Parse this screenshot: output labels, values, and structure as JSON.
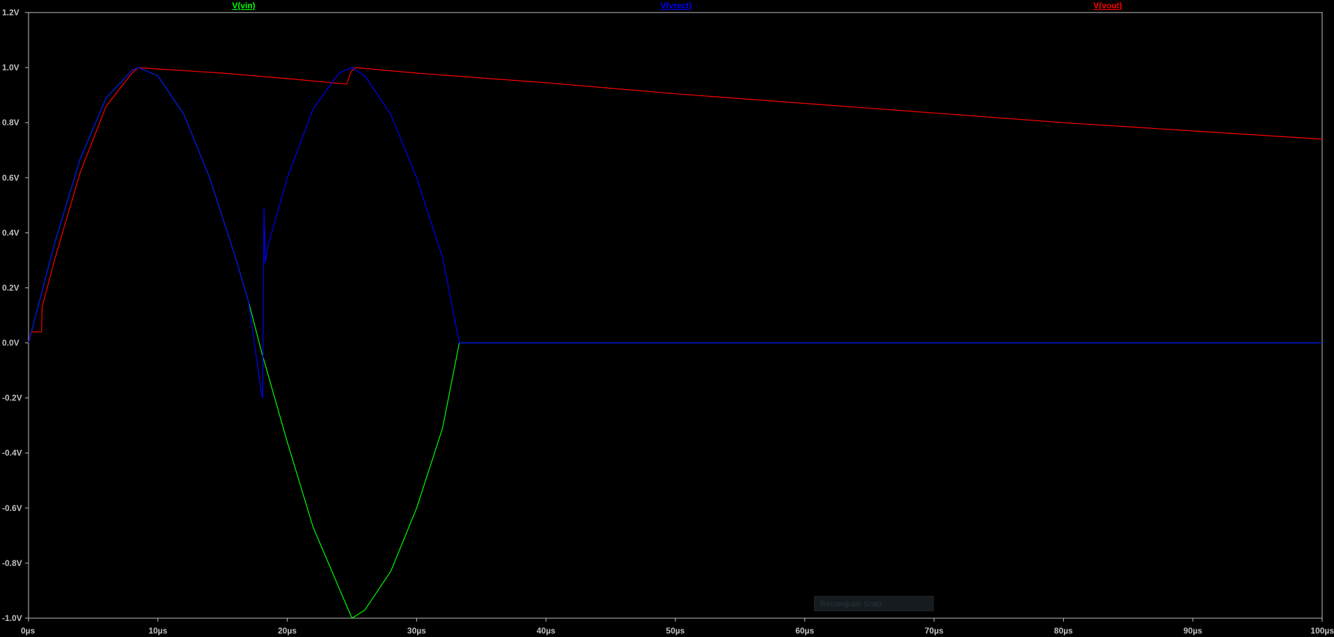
{
  "chart_data": {
    "type": "line",
    "x_unit": "µs",
    "y_unit": "V",
    "xlim": [
      0,
      100
    ],
    "ylim": [
      -1.0,
      1.2
    ],
    "x_ticks": [
      "0µs",
      "10µs",
      "20µs",
      "30µs",
      "40µs",
      "50µs",
      "60µs",
      "70µs",
      "80µs",
      "90µs",
      "100µs"
    ],
    "y_ticks": [
      "1.2V",
      "1.0V",
      "0.8V",
      "0.6V",
      "0.4V",
      "0.2V",
      "0.0V",
      "-0.2V",
      "-0.4V",
      "-0.6V",
      "-0.8V",
      "-1.0V"
    ],
    "series": [
      {
        "name": "V(vin)",
        "color": "#00ff00",
        "x": [
          0,
          2,
          4,
          6,
          8,
          8.5,
          10,
          12,
          14,
          16,
          17,
          18,
          20,
          22,
          24,
          25,
          26,
          28,
          30,
          32,
          33.3,
          34,
          40,
          50,
          60,
          70,
          80,
          90,
          100
        ],
        "y": [
          0,
          0.36,
          0.67,
          0.89,
          0.99,
          1.0,
          0.97,
          0.83,
          0.6,
          0.31,
          0.15,
          -0.03,
          -0.36,
          -0.67,
          -0.89,
          -1.0,
          -0.97,
          -0.83,
          -0.6,
          -0.31,
          0,
          0,
          0,
          0,
          0,
          0,
          0,
          0,
          0
        ]
      },
      {
        "name": "V(vrect)",
        "color": "#0000ff",
        "x": [
          0,
          2,
          4,
          6,
          8,
          8.5,
          10,
          12,
          14,
          16,
          17,
          18,
          18.1,
          18.2,
          18.3,
          18.5,
          20,
          22,
          24,
          25,
          26,
          28,
          30,
          32,
          33.3,
          34,
          40,
          50,
          60,
          70,
          80,
          90,
          100
        ],
        "y": [
          0,
          0.36,
          0.67,
          0.89,
          0.99,
          1.0,
          0.97,
          0.83,
          0.6,
          0.31,
          0.15,
          -0.18,
          -0.2,
          0.49,
          0.29,
          0.35,
          0.6,
          0.85,
          0.98,
          1.0,
          0.97,
          0.83,
          0.6,
          0.31,
          0,
          0,
          0,
          0,
          0,
          0,
          0,
          0,
          0
        ]
      },
      {
        "name": "V(vout)",
        "color": "#ff0000",
        "x": [
          0,
          0.2,
          1,
          1.05,
          2,
          4,
          6,
          8,
          8.5,
          10,
          15,
          20,
          24.6,
          24.8,
          25,
          25.3,
          30,
          40,
          50,
          60,
          70,
          80,
          90,
          100
        ],
        "y": [
          0,
          0.04,
          0.04,
          0.13,
          0.3,
          0.62,
          0.86,
          0.98,
          1.0,
          0.995,
          0.98,
          0.96,
          0.94,
          0.97,
          0.99,
          1.0,
          0.98,
          0.945,
          0.905,
          0.87,
          0.835,
          0.8,
          0.77,
          0.74
        ]
      }
    ],
    "grid": false,
    "legend_position": "top"
  },
  "tooltip": {
    "text": "Rectangular Snap"
  }
}
